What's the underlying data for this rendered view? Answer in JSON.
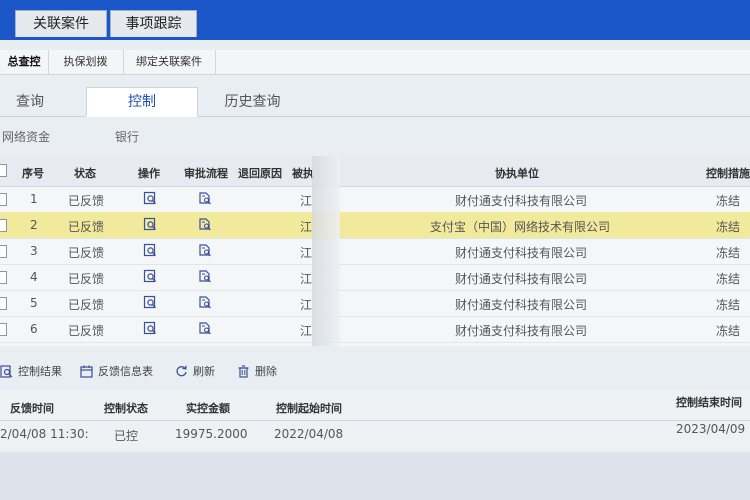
{
  "top_tabs": [
    "关联案件",
    "事项跟踪"
  ],
  "sub_tabs": [
    "总查控",
    "执保划拨",
    "绑定关联案件"
  ],
  "function_tabs": [
    "查询",
    "控制",
    "历史查询"
  ],
  "form": {
    "label_1": "网络资金",
    "label_2": "银行"
  },
  "table": {
    "headers": [
      "序号",
      "状态",
      "操作",
      "审批流程",
      "退回原因",
      "被执",
      "协执单位",
      "控制措施"
    ],
    "rows": [
      {
        "no": "1",
        "status": "已反馈",
        "mark": "江",
        "unit": "财付通支付科技有限公司",
        "measure": "冻结"
      },
      {
        "no": "2",
        "status": "已反馈",
        "mark": "江",
        "unit": "支付宝（中国）网络技术有限公司",
        "measure": "冻结"
      },
      {
        "no": "3",
        "status": "已反馈",
        "mark": "江",
        "unit": "财付通支付科技有限公司",
        "measure": "冻结"
      },
      {
        "no": "4",
        "status": "已反馈",
        "mark": "江",
        "unit": "财付通支付科技有限公司",
        "measure": "冻结"
      },
      {
        "no": "5",
        "status": "已反馈",
        "mark": "江",
        "unit": "财付通支付科技有限公司",
        "measure": "冻结"
      },
      {
        "no": "6",
        "status": "已反馈",
        "mark": "江",
        "unit": "财付通支付科技有限公司",
        "measure": "冻结"
      }
    ]
  },
  "toolbar": {
    "control_result": "控制结果",
    "feedback_table": "反馈信息表",
    "refresh": "刷新",
    "delete": "删除"
  },
  "bottom_table": {
    "headers": [
      "反馈时间",
      "控制状态",
      "实控金额",
      "控制起始时间",
      "控制结束时间"
    ],
    "row": [
      "2/04/08 11:30:",
      "已控",
      "19975.2000",
      "2022/04/08",
      "2023/04/09"
    ]
  },
  "colors": {
    "topbar": "#1a56c8",
    "selected_row": "#f1ea9d",
    "active_tab_text": "#1f4fb8",
    "icon": "#3a4f9a"
  }
}
